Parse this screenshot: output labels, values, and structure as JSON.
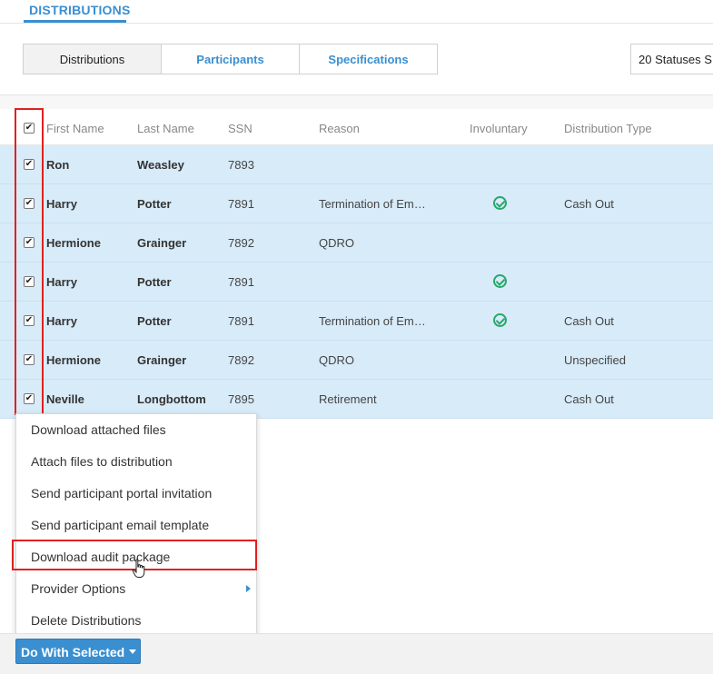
{
  "header": {
    "title": "DISTRIBUTIONS"
  },
  "tabs": [
    {
      "label": "Distributions",
      "active": true
    },
    {
      "label": "Participants",
      "active": false
    },
    {
      "label": "Specifications",
      "active": false
    }
  ],
  "status_filter": {
    "label": "20 Statuses S"
  },
  "table": {
    "header_checked": true,
    "columns": [
      "First Name",
      "Last Name",
      "SSN",
      "Reason",
      "Involuntary",
      "Distribution Type"
    ],
    "rows": [
      {
        "first": "Ron",
        "last": "Weasley",
        "ssn": "7893",
        "reason": "",
        "involuntary": false,
        "type": ""
      },
      {
        "first": "Harry",
        "last": "Potter",
        "ssn": "7891",
        "reason": "Termination of Em…",
        "involuntary": true,
        "type": "Cash Out"
      },
      {
        "first": "Hermione",
        "last": "Grainger",
        "ssn": "7892",
        "reason": "QDRO",
        "involuntary": false,
        "type": ""
      },
      {
        "first": "Harry",
        "last": "Potter",
        "ssn": "7891",
        "reason": "",
        "involuntary": true,
        "type": ""
      },
      {
        "first": "Harry",
        "last": "Potter",
        "ssn": "7891",
        "reason": "Termination of Em…",
        "involuntary": true,
        "type": "Cash Out"
      },
      {
        "first": "Hermione",
        "last": "Grainger",
        "ssn": "7892",
        "reason": "QDRO",
        "involuntary": false,
        "type": "Unspecified"
      },
      {
        "first": "Neville",
        "last": "Longbottom",
        "ssn": "7895",
        "reason": "Retirement",
        "involuntary": false,
        "type": "Cash Out"
      }
    ]
  },
  "menu": {
    "items": [
      {
        "label": "Download attached files",
        "submenu": false
      },
      {
        "label": "Attach files to distribution",
        "submenu": false
      },
      {
        "label": "Send participant portal invitation",
        "submenu": false
      },
      {
        "label": "Send participant email template",
        "submenu": false
      },
      {
        "label": "Download audit package",
        "submenu": false
      },
      {
        "label": "Provider Options",
        "submenu": true
      },
      {
        "label": "Delete Distributions",
        "submenu": false
      }
    ]
  },
  "footer": {
    "do_with_selected": "Do With Selected"
  },
  "colors": {
    "accent": "#3a8fd1",
    "selected_row": "#d8ebf9",
    "highlight": "#e02020",
    "success": "#28a86b"
  }
}
